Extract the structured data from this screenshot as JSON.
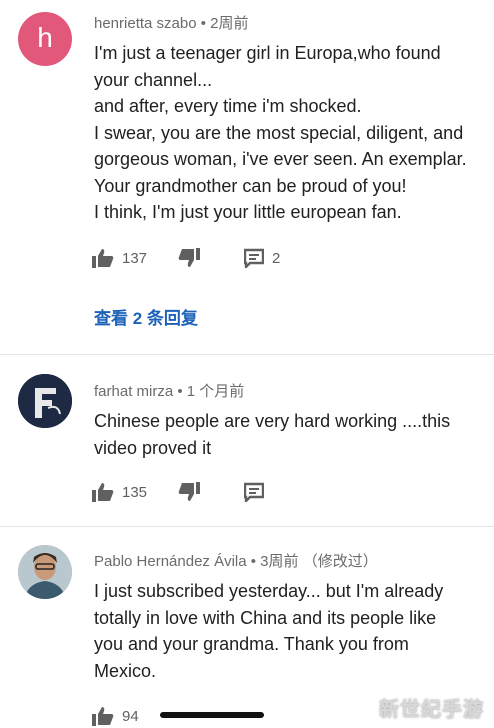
{
  "comments": [
    {
      "author": "henrietta szabo",
      "time": "• 2周前",
      "avatar_letter": "h",
      "lines": [
        "I'm just a teenager girl in Europa,who found",
        "your channel...",
        "and after, every time i'm shocked.",
        "I swear, you are the most special, diligent, and",
        "gorgeous woman, i've ever seen. An exemplar.",
        "Your grandmother can be proud of you!",
        "I think, I'm just your little european fan."
      ],
      "likes": "137",
      "reply_count": "2",
      "view_replies": "查看 2 条回复"
    },
    {
      "author": "farhat mirza",
      "time": "• 1 个月前",
      "lines": [
        "Chinese people are very hard working ....this",
        "video proved it"
      ],
      "likes": "135"
    },
    {
      "author": "Pablo Hernández Ávila",
      "time": "• 3周前 （修改过）",
      "lines": [
        "I just subscribed yesterday... but I'm already",
        "totally in love with China and its people like",
        "you and your grandma. Thank you from",
        "Mexico."
      ],
      "likes": "94"
    }
  ],
  "watermark": "新世纪手游",
  "icons": {
    "like": "thumbs-up-icon",
    "dislike": "thumbs-down-icon",
    "reply": "reply-comment-icon"
  }
}
